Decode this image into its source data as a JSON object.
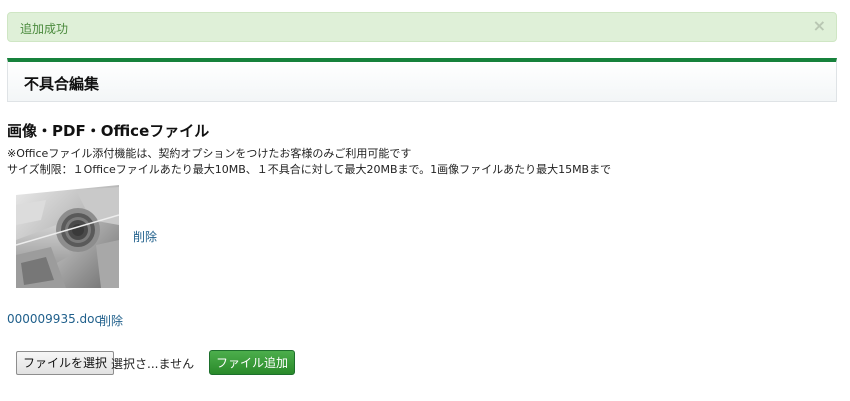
{
  "alert": {
    "message": "追加成功",
    "close_icon": "×"
  },
  "panel": {
    "title": "不具合編集"
  },
  "files_section": {
    "title": "画像・PDF・Officeファイル",
    "note_office": "※Officeファイル添付機能は、契約オプションをつけたお客様のみご利用可能です",
    "note_size": "サイズ制限：１Officeファイルあたり最大10MB、１不具合に対して最大20MBまで。1画像ファイルあたり最大15MBまで",
    "image_item": {
      "delete_label": "削除"
    },
    "doc_item": {
      "filename": "000009935.doc",
      "delete_label": "削除"
    },
    "upload": {
      "choose_label": "ファイルを選択",
      "status_text": "選択さ...ません",
      "add_label": "ファイル追加"
    }
  },
  "colors": {
    "accent_green": "#17823c",
    "alert_bg": "#dff0d8",
    "link": "#1f5f8b",
    "add_button": "#2a8a2a"
  }
}
